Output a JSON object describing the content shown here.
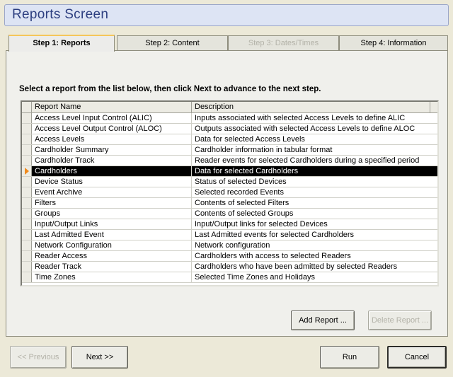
{
  "window": {
    "title": "Reports Screen"
  },
  "tabs": [
    {
      "label": "Step 1: Reports",
      "state": "active"
    },
    {
      "label": "Step 2: Content",
      "state": "normal"
    },
    {
      "label": "Step 3: Dates/Times",
      "state": "disabled"
    },
    {
      "label": "Step 4: Information",
      "state": "normal"
    }
  ],
  "instruction": "Select a report from the list below, then click Next to advance to the next step.",
  "grid": {
    "columns": [
      "Report Name",
      "Description"
    ],
    "rows": [
      [
        "Access Level Input Control (ALIC)",
        "Inputs associated with selected Access Levels to define ALIC"
      ],
      [
        "Access Level Output Control (ALOC)",
        "Outputs associated with selected Access Levels to define ALOC"
      ],
      [
        "Access Levels",
        "Data for selected Access Levels"
      ],
      [
        "Cardholder Summary",
        "Cardholder information in tabular format"
      ],
      [
        "Cardholder Track",
        "Reader events for selected Cardholders during a specified period"
      ],
      [
        "Cardholders",
        "Data for selected Cardholders"
      ],
      [
        "Device Status",
        "Status of selected Devices"
      ],
      [
        "Event Archive",
        "Selected recorded Events"
      ],
      [
        "Filters",
        "Contents of selected Filters"
      ],
      [
        "Groups",
        "Contents of selected Groups"
      ],
      [
        "Input/Output Links",
        "Input/Output links for selected Devices"
      ],
      [
        "Last Admitted Event",
        "Last Admitted events for selected Cardholders"
      ],
      [
        "Network Configuration",
        "Network configuration"
      ],
      [
        "Reader Access",
        "Cardholders with access to selected Readers"
      ],
      [
        "Reader Track",
        "Cardholders who have been admitted by selected Readers"
      ],
      [
        "Time Zones",
        "Selected Time Zones and Holidays"
      ]
    ],
    "selected_index": 5
  },
  "buttons": {
    "add_report": "Add Report ...",
    "delete_report": "Delete Report ...",
    "previous": "<< Previous",
    "next": "Next >>",
    "run": "Run",
    "cancel": "Cancel"
  },
  "colors": {
    "title_text": "#2d3f80",
    "selection_bg": "#000000",
    "selection_marker": "#f08a1c",
    "active_tab_accent": "#f5c65a"
  }
}
